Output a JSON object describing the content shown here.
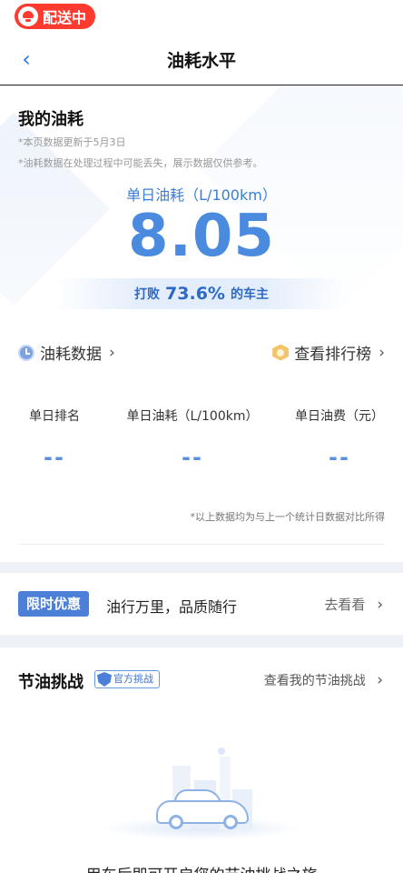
{
  "status": {
    "delivery_label": "配送中"
  },
  "navbar": {
    "title": "油耗水平",
    "back_glyph": "‹"
  },
  "summary": {
    "title": "我的油耗",
    "update_note": "*本页数据更新于5月3日",
    "disclaimer": "*油耗数据在处理过程中可能丢失，展示数据仅供参考。",
    "metric_label": "单日油耗（L/100km）",
    "metric_value": "8.05",
    "beat_prefix": "打败",
    "beat_percent": "73.6%",
    "beat_suffix": "的车主"
  },
  "links": {
    "fuel_data": "油耗数据",
    "ranking": "查看排行榜",
    "chevron": "›"
  },
  "stats": {
    "columns": [
      {
        "label": "单日排名",
        "value": "--"
      },
      {
        "label": "单日油耗（L/100km）",
        "value": "--"
      },
      {
        "label": "单日油费（元）",
        "value": "--"
      }
    ],
    "footnote": "*以上数据均为与上一个统计日数据对比所得"
  },
  "promo": {
    "tag": "限时优惠",
    "text": "油行万里，品质随行",
    "link": "去看看"
  },
  "challenge": {
    "title": "节油挑战",
    "badge": "官方挑战",
    "link": "查看我的节油挑战",
    "empty_text": "用车后即可开启您的节油挑战之旅"
  },
  "colors": {
    "accent": "#4a8be0",
    "brand_red": "#ff3b30",
    "promo_tag": "#4b7fd8"
  },
  "icons": [
    "back-arrow-icon",
    "clock-icon",
    "medal-icon",
    "chevron-right-icon",
    "shield-icon"
  ]
}
